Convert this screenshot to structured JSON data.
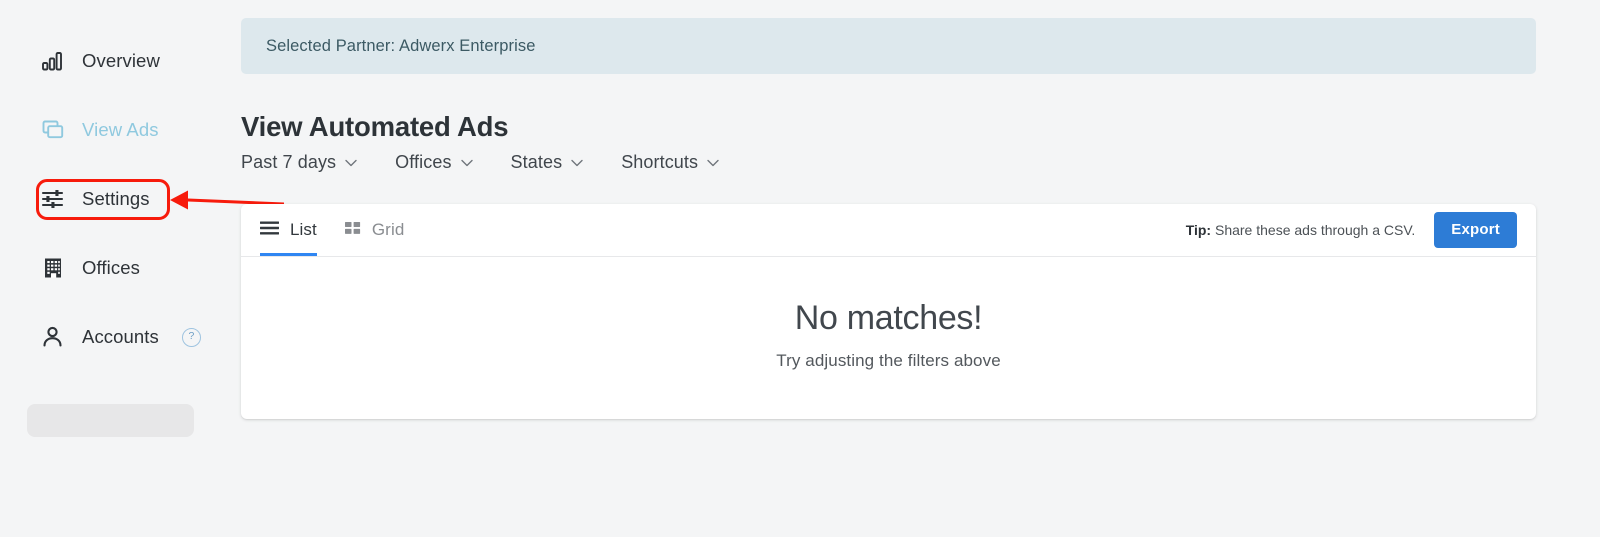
{
  "sidebar": {
    "items": [
      {
        "id": "overview",
        "label": "Overview",
        "icon": "bar-chart-icon",
        "active": false
      },
      {
        "id": "view-ads",
        "label": "View Ads",
        "icon": "copy-windows-icon",
        "active": true
      },
      {
        "id": "settings",
        "label": "Settings",
        "icon": "sliders-icon",
        "active": false
      },
      {
        "id": "offices",
        "label": "Offices",
        "icon": "building-icon",
        "active": false
      },
      {
        "id": "accounts",
        "label": "Accounts",
        "icon": "person-icon",
        "active": false,
        "help_badge": "?"
      }
    ],
    "placeholder_visible": true
  },
  "annotation": {
    "highlight_target": "Settings",
    "arrow_color": "#f71b0c",
    "box_color": "#f71b0c"
  },
  "banner": {
    "text": "Selected Partner: Adwerx Enterprise",
    "background": "#dde8ed",
    "text_color": "#3c5a64"
  },
  "page": {
    "title": "View Automated Ads"
  },
  "filters": [
    {
      "id": "date-range",
      "label": "Past 7 days",
      "icon": "chevron-down-icon"
    },
    {
      "id": "offices",
      "label": "Offices",
      "icon": "chevron-down-icon"
    },
    {
      "id": "states",
      "label": "States",
      "icon": "chevron-down-icon"
    },
    {
      "id": "shortcuts",
      "label": "Shortcuts",
      "icon": "chevron-down-icon"
    }
  ],
  "card": {
    "tabs": [
      {
        "id": "list",
        "label": "List",
        "icon": "list-lines-icon",
        "active": true
      },
      {
        "id": "grid",
        "label": "Grid",
        "icon": "grid-squares-icon",
        "active": false
      }
    ],
    "tip": {
      "prefix": "Tip:",
      "text": " Share these ads through a CSV."
    },
    "export_label": "Export",
    "export_color": "#2d7cd6",
    "empty_state": {
      "title": "No matches!",
      "subtitle": "Try adjusting the filters above"
    }
  }
}
